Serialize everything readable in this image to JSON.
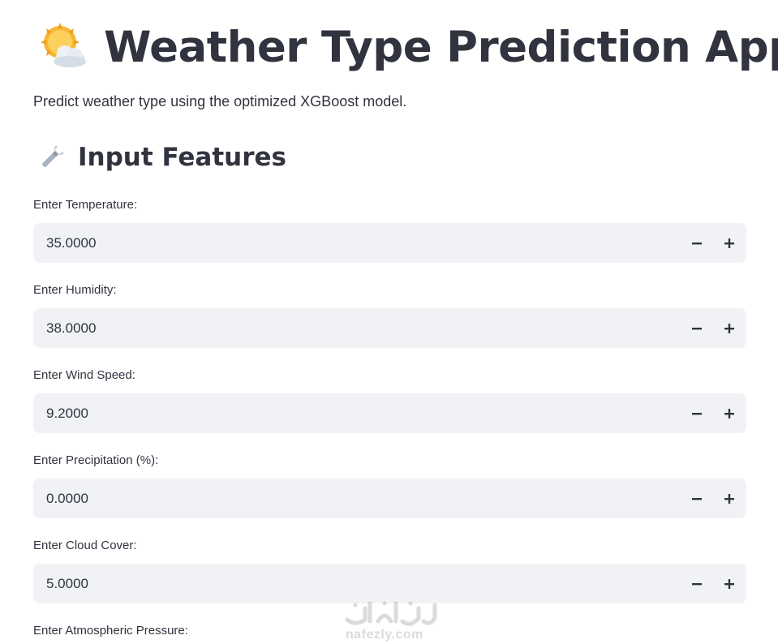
{
  "header": {
    "icon": "sun-behind-cloud-icon",
    "title": "Weather Type Prediction App",
    "subtitle": "Predict weather type using the optimized XGBoost model."
  },
  "section": {
    "icon": "wrench-icon",
    "title": "Input Features"
  },
  "fields": [
    {
      "label": "Enter Temperature:",
      "value": "35.0000"
    },
    {
      "label": "Enter Humidity:",
      "value": "38.0000"
    },
    {
      "label": "Enter Wind Speed:",
      "value": "9.2000"
    },
    {
      "label": "Enter Precipitation (%):",
      "value": "0.0000"
    },
    {
      "label": "Enter Cloud Cover:",
      "value": "5.0000"
    },
    {
      "label": "Enter Atmospheric Pressure:",
      "value": ""
    }
  ],
  "stepper": {
    "minus_icon": "minus-icon",
    "plus_icon": "plus-icon"
  },
  "watermark": {
    "text": "nafezly.com"
  },
  "colors": {
    "text": "#31333f",
    "input_bg": "#f0f2f6",
    "sun": "#f5b82e",
    "cloud": "#e8eef5"
  }
}
